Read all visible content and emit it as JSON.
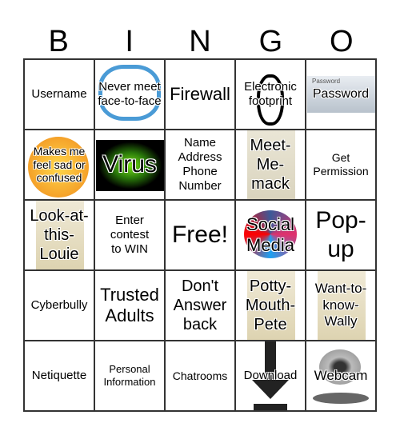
{
  "header": [
    "B",
    "I",
    "N",
    "G",
    "O"
  ],
  "cells": [
    "Username",
    "Never meet face-to-face",
    "Firewall",
    "Electronic footprint",
    "Password",
    "Makes me feel sad or confused",
    "Virus",
    "Name Address Phone Number",
    "Meet-Me-mack",
    "Get Permission",
    "Look-at-this-Louie",
    "Enter contest to WIN",
    "Free!",
    "Social Media",
    "Pop-up",
    "Cyberbully",
    "Trusted Adults",
    "Don't Answer back",
    "Potty-Mouth-Pete",
    "Want-to-know-Wally",
    "Netiquette",
    "Personal Information",
    "Chatrooms",
    "Download",
    "Webcam"
  ],
  "password_image_label": "Password"
}
